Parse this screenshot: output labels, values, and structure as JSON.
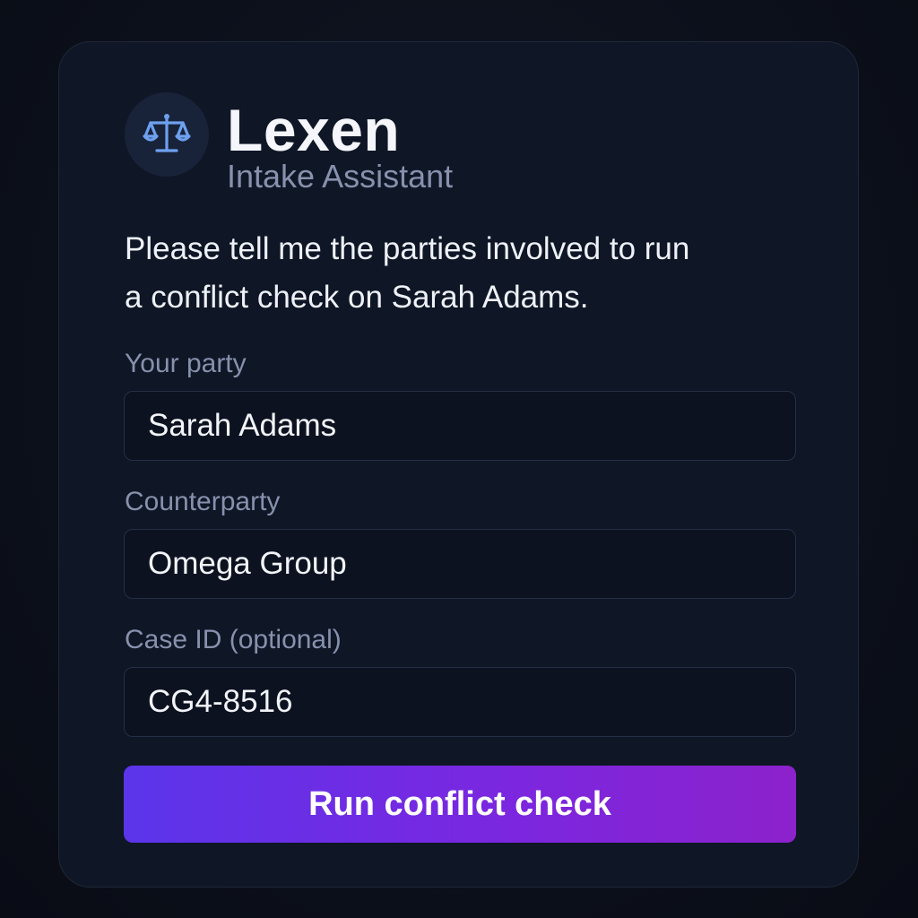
{
  "brand": {
    "icon": "scales-icon",
    "title": "Lexen",
    "subtitle": "Intake Assistant"
  },
  "prompt": {
    "line1": "Please tell me the parties involved to run",
    "line2": "a conflict check on Sarah Adams."
  },
  "form": {
    "your_party": {
      "label": "Your party",
      "value": "Sarah Adams"
    },
    "counterparty": {
      "label": "Counterparty",
      "value": "Omega Group"
    },
    "case_id": {
      "label": "Case ID (optional)",
      "value": "CG4-8516"
    },
    "submit_label": "Run conflict check"
  },
  "colors": {
    "background": "#0b0f19",
    "card": "#0f1626",
    "accent_start": "#5b35ea",
    "accent_end": "#8c22cc",
    "icon": "#6ea0f0",
    "muted_text": "#8791ad"
  }
}
